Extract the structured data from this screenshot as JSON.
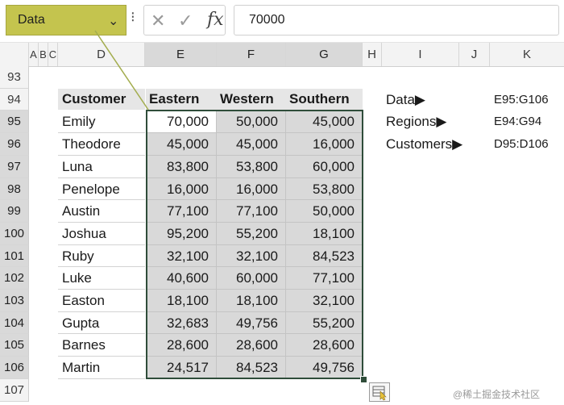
{
  "name_box": {
    "value": "Data"
  },
  "formula_bar": {
    "cancel_glyph": "✕",
    "enter_glyph": "✓",
    "fx_label": "fx",
    "value": "70000"
  },
  "columns": [
    "A",
    "B",
    "C",
    "D",
    "E",
    "F",
    "G",
    "H",
    "I",
    "J",
    "K"
  ],
  "rows": [
    "93",
    "94",
    "95",
    "96",
    "97",
    "98",
    "99",
    "100",
    "101",
    "102",
    "103",
    "104",
    "105",
    "106",
    "107"
  ],
  "table": {
    "headers": [
      "Customer",
      "Eastern",
      "Western",
      "Southern"
    ],
    "records": [
      {
        "customer": "Emily",
        "eastern": "70,000",
        "western": "50,000",
        "southern": "45,000"
      },
      {
        "customer": "Theodore",
        "eastern": "45,000",
        "western": "45,000",
        "southern": "16,000"
      },
      {
        "customer": "Luna",
        "eastern": "83,800",
        "western": "53,800",
        "southern": "60,000"
      },
      {
        "customer": "Penelope",
        "eastern": "16,000",
        "western": "16,000",
        "southern": "53,800"
      },
      {
        "customer": "Austin",
        "eastern": "77,100",
        "western": "77,100",
        "southern": "50,000"
      },
      {
        "customer": "Joshua",
        "eastern": "95,200",
        "western": "55,200",
        "southern": "18,100"
      },
      {
        "customer": "Ruby",
        "eastern": "32,100",
        "western": "32,100",
        "southern": "84,523"
      },
      {
        "customer": "Luke",
        "eastern": "40,600",
        "western": "60,000",
        "southern": "77,100"
      },
      {
        "customer": "Easton",
        "eastern": "18,100",
        "western": "18,100",
        "southern": "32,100"
      },
      {
        "customer": "Gupta",
        "eastern": "32,683",
        "western": "49,756",
        "southern": "55,200"
      },
      {
        "customer": "Barnes",
        "eastern": "28,600",
        "western": "28,600",
        "southern": "28,600"
      },
      {
        "customer": "Martin",
        "eastern": "24,517",
        "western": "84,523",
        "southern": "49,756"
      }
    ]
  },
  "named_ranges": [
    {
      "label": "Data▶",
      "ref": "E95:G106"
    },
    {
      "label": "Regions▶",
      "ref": "E94:G94"
    },
    {
      "label": "Customers▶",
      "ref": "D95:D106"
    }
  ],
  "watermark": "@稀土掘金技术社区",
  "colors": {
    "name_box_fill": "#c4c44e",
    "selection_border": "#2f4d3a",
    "data_fill": "#d9d9d9",
    "callout_line": "#a3ad4f"
  },
  "icons": {
    "name_box_dropdown": "chevron-down-icon",
    "quick_analysis": "quick-analysis-icon"
  }
}
